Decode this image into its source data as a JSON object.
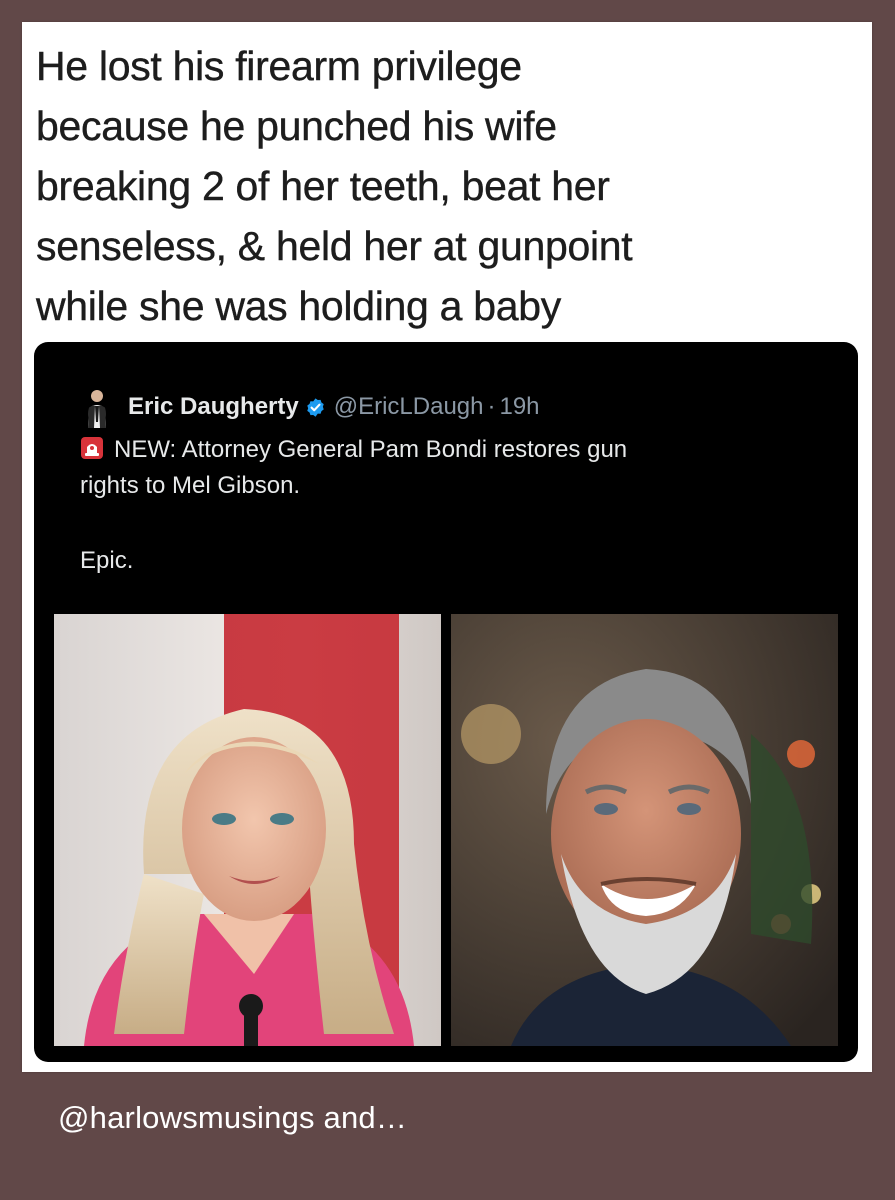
{
  "caption": {
    "line1": "He lost his firearm privilege",
    "line2": "because he punched his wife",
    "line3": "breaking 2 of her teeth, beat her",
    "line4": "senseless, & held her at gunpoint",
    "line5": "while she was holding a baby"
  },
  "tweet": {
    "author_name": "Eric Daugherty",
    "handle": "@EricLDaugh",
    "separator": "·",
    "time": "19h",
    "text_line1": "NEW: Attorney General Pam Bondi restores gun",
    "text_line2": "rights to Mel Gibson.",
    "text_epic": "Epic.",
    "icons": [
      "person-avatar-icon",
      "verified-badge-icon",
      "siren-emoji-icon"
    ],
    "photos": [
      "woman-blonde-pink-blazer-photo",
      "man-grey-beard-smiling-photo"
    ]
  },
  "credit": {
    "text": "@harlowsmusings and…"
  },
  "colors": {
    "page_background": "#614848",
    "card_background": "#ffffff",
    "tweet_background": "#000000",
    "verified_blue": "#1d9bf0",
    "muted_text": "#8b98a5"
  }
}
